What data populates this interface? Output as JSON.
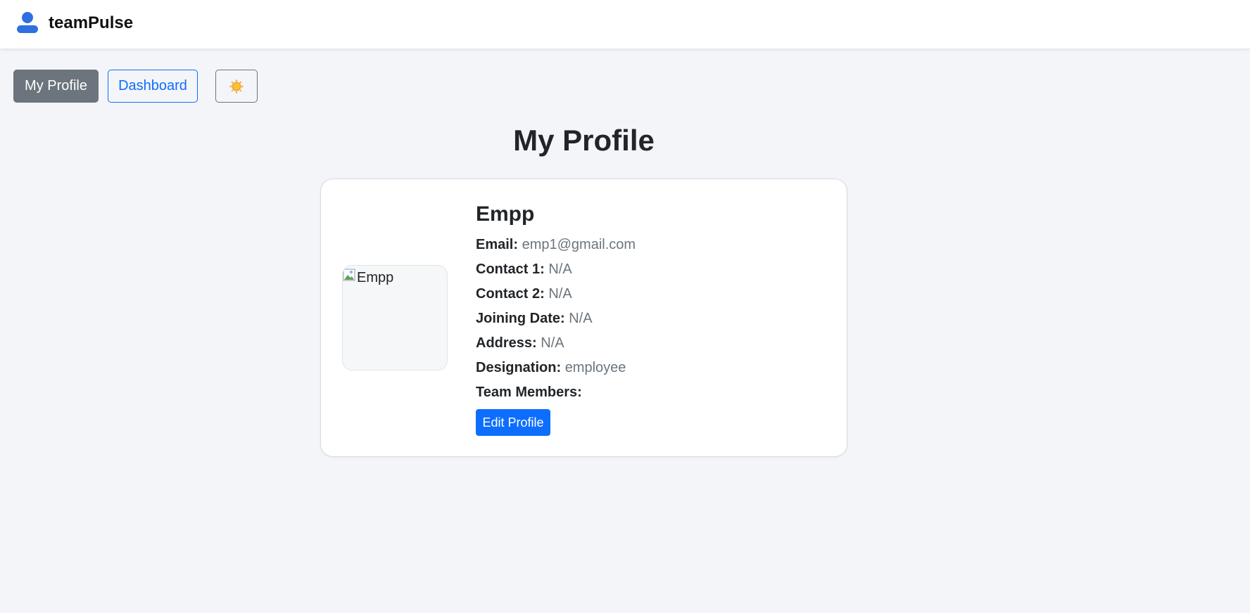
{
  "app": {
    "name": "teamPulse",
    "icon": "user-icon"
  },
  "nav": {
    "profile_label": "My Profile",
    "dashboard_label": "Dashboard",
    "theme_icon": "sun-icon"
  },
  "page": {
    "title": "My Profile"
  },
  "profile": {
    "name": "Empp",
    "avatar_alt": "Empp",
    "fields": [
      {
        "label": "Email:",
        "value": "emp1@gmail.com"
      },
      {
        "label": "Contact 1:",
        "value": "N/A"
      },
      {
        "label": "Contact 2:",
        "value": "N/A"
      },
      {
        "label": "Joining Date:",
        "value": "N/A"
      },
      {
        "label": "Address:",
        "value": "N/A"
      },
      {
        "label": "Designation:",
        "value": "employee"
      },
      {
        "label": "Team Members:",
        "value": ""
      }
    ],
    "edit_label": "Edit Profile"
  },
  "colors": {
    "primary": "#0d6efd",
    "secondary": "#6c757d",
    "background": "#f4f5f8",
    "brand_icon": "#2f6fe0"
  }
}
